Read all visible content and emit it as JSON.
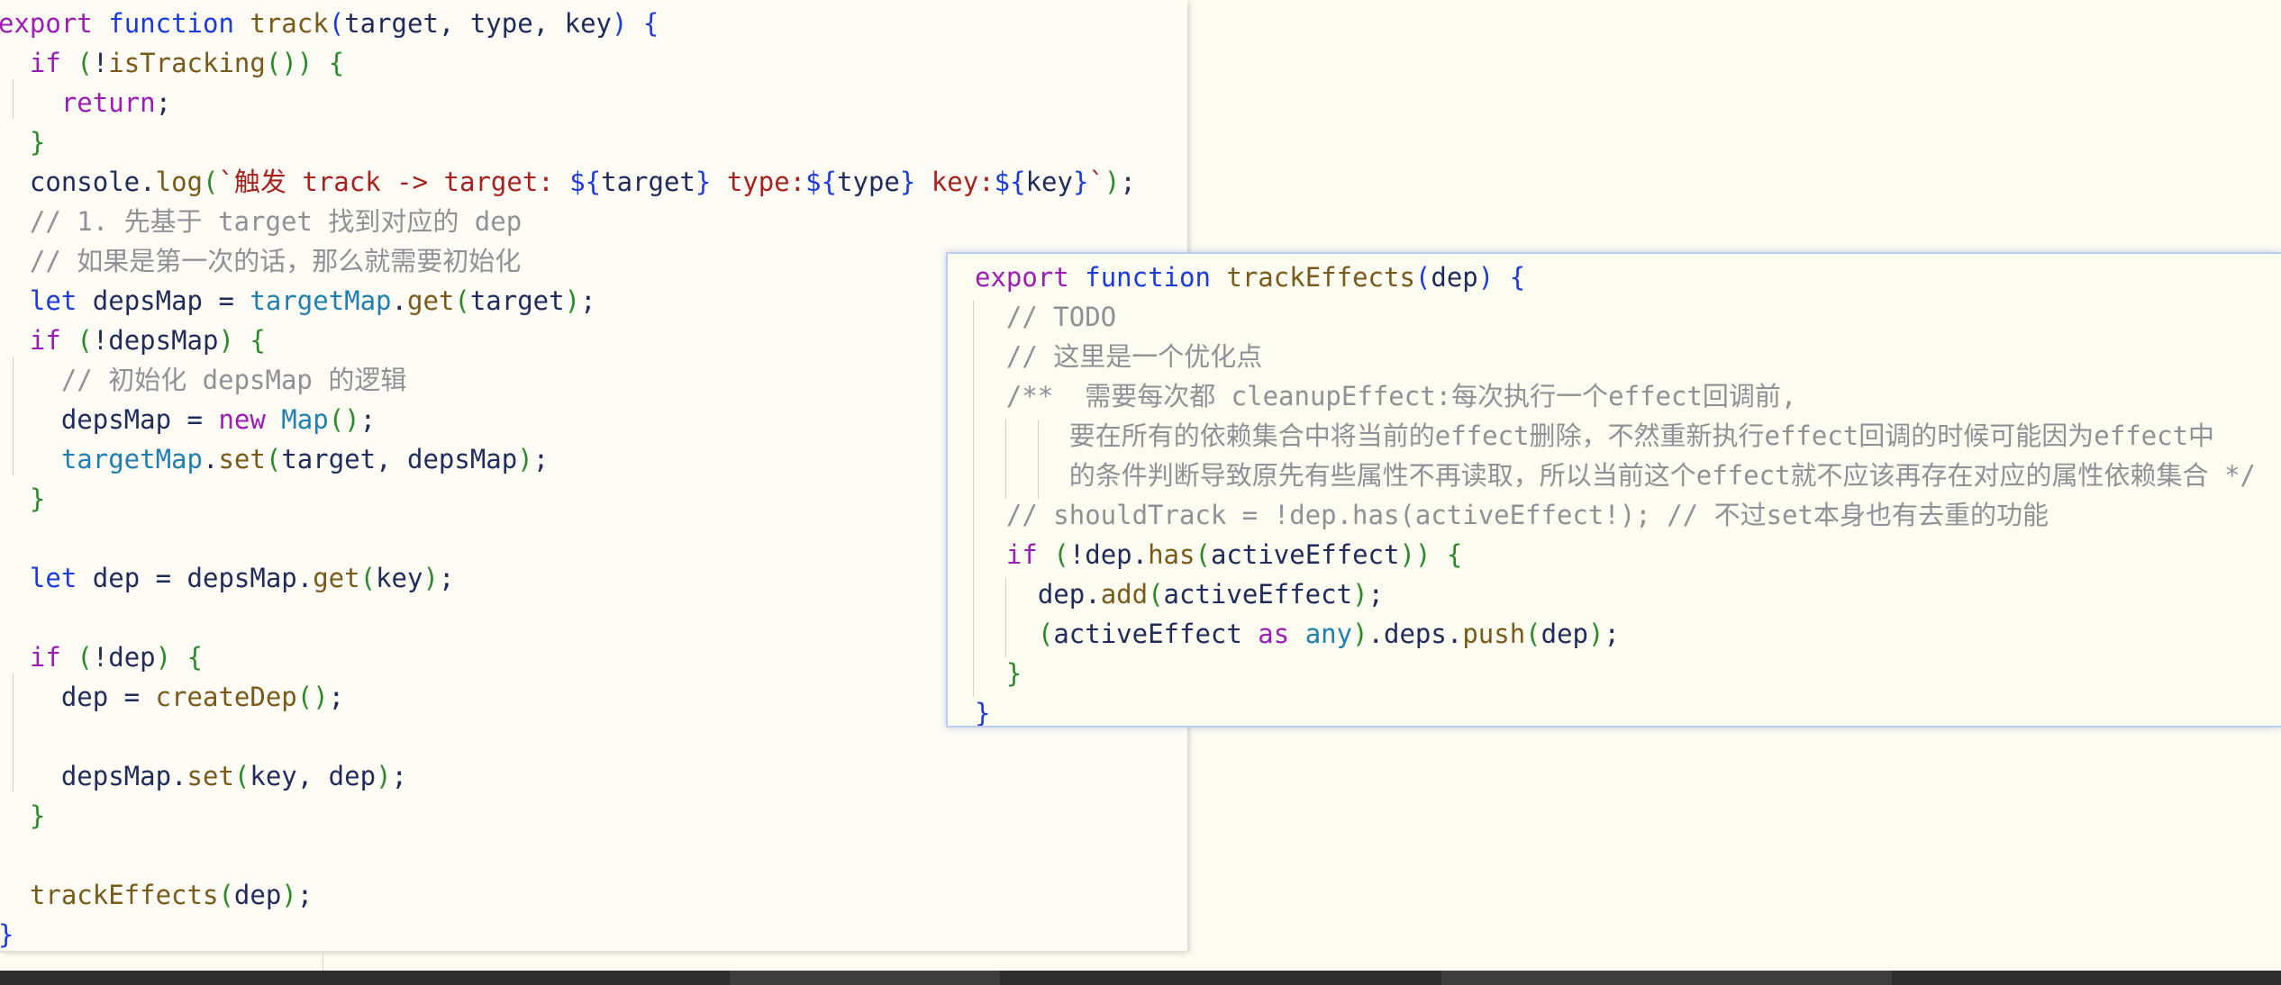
{
  "editor": {
    "lines": [
      [
        [
          "kw",
          "export"
        ],
        [
          "id",
          " "
        ],
        [
          "kw2",
          "function"
        ],
        [
          "id",
          " "
        ],
        [
          "fn",
          "track"
        ],
        [
          "br",
          "("
        ],
        [
          "id",
          "target, type, key"
        ],
        [
          "br",
          ")"
        ],
        [
          "id",
          " "
        ],
        [
          "br",
          "{"
        ]
      ],
      [
        [
          "id",
          "  "
        ],
        [
          "kw",
          "if"
        ],
        [
          "id",
          " "
        ],
        [
          "pn",
          "("
        ],
        [
          "id",
          "!"
        ],
        [
          "fn",
          "isTracking"
        ],
        [
          "pn",
          "()"
        ],
        [
          "pn",
          ")"
        ],
        [
          "id",
          " "
        ],
        [
          "pn",
          "{"
        ]
      ],
      [
        [
          "id",
          "    "
        ],
        [
          "kw",
          "return"
        ],
        [
          "id",
          ";"
        ]
      ],
      [
        [
          "id",
          "  "
        ],
        [
          "pn",
          "}"
        ]
      ],
      [
        [
          "id",
          "  console."
        ],
        [
          "fn",
          "log"
        ],
        [
          "pn",
          "("
        ],
        [
          "str",
          "`触发 track -> target: "
        ],
        [
          "br",
          "${"
        ],
        [
          "id",
          "target"
        ],
        [
          "br",
          "}"
        ],
        [
          "str",
          " type:"
        ],
        [
          "br",
          "${"
        ],
        [
          "id",
          "type"
        ],
        [
          "br",
          "}"
        ],
        [
          "str",
          " key:"
        ],
        [
          "br",
          "${"
        ],
        [
          "id",
          "key"
        ],
        [
          "br",
          "}"
        ],
        [
          "str",
          "`"
        ],
        [
          "pn",
          ")"
        ],
        [
          "id",
          ";"
        ]
      ],
      [
        [
          "cm",
          "  // 1. 先基于 target 找到对应的 dep"
        ]
      ],
      [
        [
          "cm",
          "  // 如果是第一次的话，那么就需要初始化"
        ]
      ],
      [
        [
          "id",
          "  "
        ],
        [
          "kw2",
          "let"
        ],
        [
          "id",
          " depsMap = "
        ],
        [
          "ty",
          "targetMap"
        ],
        [
          "id",
          "."
        ],
        [
          "fn",
          "get"
        ],
        [
          "pn",
          "("
        ],
        [
          "id",
          "target"
        ],
        [
          "pn",
          ")"
        ],
        [
          "id",
          ";"
        ]
      ],
      [
        [
          "id",
          "  "
        ],
        [
          "kw",
          "if"
        ],
        [
          "id",
          " "
        ],
        [
          "pn",
          "("
        ],
        [
          "id",
          "!depsMap"
        ],
        [
          "pn",
          ")"
        ],
        [
          "id",
          " "
        ],
        [
          "pn",
          "{"
        ]
      ],
      [
        [
          "cm",
          "    // 初始化 depsMap 的逻辑"
        ]
      ],
      [
        [
          "id",
          "    depsMap = "
        ],
        [
          "kw",
          "new"
        ],
        [
          "id",
          " "
        ],
        [
          "ty",
          "Map"
        ],
        [
          "pn",
          "()"
        ],
        [
          "id",
          ";"
        ]
      ],
      [
        [
          "id",
          "    "
        ],
        [
          "ty",
          "targetMap"
        ],
        [
          "id",
          "."
        ],
        [
          "fn",
          "set"
        ],
        [
          "pn",
          "("
        ],
        [
          "id",
          "target, depsMap"
        ],
        [
          "pn",
          ")"
        ],
        [
          "id",
          ";"
        ]
      ],
      [
        [
          "id",
          "  "
        ],
        [
          "pn",
          "}"
        ]
      ],
      [
        [
          "id",
          ""
        ]
      ],
      [
        [
          "id",
          "  "
        ],
        [
          "kw2",
          "let"
        ],
        [
          "id",
          " dep = depsMap."
        ],
        [
          "fn",
          "get"
        ],
        [
          "pn",
          "("
        ],
        [
          "id",
          "key"
        ],
        [
          "pn",
          ")"
        ],
        [
          "id",
          ";"
        ]
      ],
      [
        [
          "id",
          ""
        ]
      ],
      [
        [
          "id",
          "  "
        ],
        [
          "kw",
          "if"
        ],
        [
          "id",
          " "
        ],
        [
          "pn",
          "("
        ],
        [
          "id",
          "!dep"
        ],
        [
          "pn",
          ")"
        ],
        [
          "id",
          " "
        ],
        [
          "pn",
          "{"
        ]
      ],
      [
        [
          "id",
          "    dep = "
        ],
        [
          "fn",
          "createDep"
        ],
        [
          "pn",
          "()"
        ],
        [
          "id",
          ";"
        ]
      ],
      [
        [
          "id",
          ""
        ]
      ],
      [
        [
          "id",
          "    depsMap."
        ],
        [
          "fn",
          "set"
        ],
        [
          "pn",
          "("
        ],
        [
          "id",
          "key, dep"
        ],
        [
          "pn",
          ")"
        ],
        [
          "id",
          ";"
        ]
      ],
      [
        [
          "id",
          "  "
        ],
        [
          "pn",
          "}"
        ]
      ],
      [
        [
          "id",
          ""
        ]
      ],
      [
        [
          "id",
          "  "
        ],
        [
          "fn",
          "trackEffects"
        ],
        [
          "pn",
          "("
        ],
        [
          "id",
          "dep"
        ],
        [
          "pn",
          ")"
        ],
        [
          "id",
          ";"
        ]
      ],
      [
        [
          "br",
          "}"
        ]
      ]
    ]
  },
  "popup": {
    "lines": [
      [
        [
          "kw",
          "export"
        ],
        [
          "id",
          " "
        ],
        [
          "kw2",
          "function"
        ],
        [
          "id",
          " "
        ],
        [
          "fn",
          "trackEffects"
        ],
        [
          "br",
          "("
        ],
        [
          "id",
          "dep"
        ],
        [
          "br",
          ")"
        ],
        [
          "id",
          " "
        ],
        [
          "br",
          "{"
        ]
      ],
      [
        [
          "cm",
          "  // TODO"
        ]
      ],
      [
        [
          "cm",
          "  // 这里是一个优化点"
        ]
      ],
      [
        [
          "cm",
          "  /**  需要每次都 cleanupEffect:每次执行一个effect回调前,"
        ]
      ],
      [
        [
          "cm",
          "      要在所有的依赖集合中将当前的effect删除，不然重新执行effect回调的时候可能因为effect中"
        ]
      ],
      [
        [
          "cm",
          "      的条件判断导致原先有些属性不再读取，所以当前这个effect就不应该再存在对应的属性依赖集合 */"
        ]
      ],
      [
        [
          "cm",
          "  // shouldTrack = !dep.has(activeEffect!); // 不过set本身也有去重的功能"
        ]
      ],
      [
        [
          "id",
          "  "
        ],
        [
          "kw",
          "if"
        ],
        [
          "id",
          " "
        ],
        [
          "pn",
          "("
        ],
        [
          "id",
          "!dep."
        ],
        [
          "fn",
          "has"
        ],
        [
          "pn",
          "("
        ],
        [
          "id",
          "activeEffect"
        ],
        [
          "pn",
          ")"
        ],
        [
          "pn",
          ")"
        ],
        [
          "id",
          " "
        ],
        [
          "pn",
          "{"
        ]
      ],
      [
        [
          "id",
          "    dep."
        ],
        [
          "fn",
          "add"
        ],
        [
          "pn",
          "("
        ],
        [
          "id",
          "activeEffect"
        ],
        [
          "pn",
          ")"
        ],
        [
          "id",
          ";"
        ]
      ],
      [
        [
          "id",
          "    "
        ],
        [
          "pn",
          "("
        ],
        [
          "id",
          "activeEffect "
        ],
        [
          "kw",
          "as"
        ],
        [
          "id",
          " "
        ],
        [
          "ty",
          "any"
        ],
        [
          "pn",
          ")"
        ],
        [
          "id",
          ".deps."
        ],
        [
          "fn",
          "push"
        ],
        [
          "pn",
          "("
        ],
        [
          "id",
          "dep"
        ],
        [
          "pn",
          ")"
        ],
        [
          "id",
          ";"
        ]
      ],
      [
        [
          "id",
          "  "
        ],
        [
          "pn",
          "}"
        ]
      ],
      [
        [
          "br",
          "}"
        ]
      ]
    ]
  }
}
